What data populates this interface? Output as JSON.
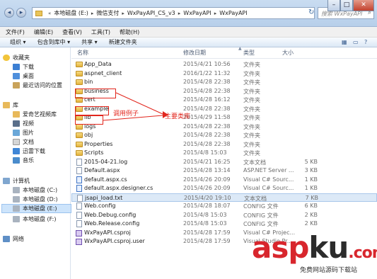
{
  "address_bar": {
    "crumbs": [
      "本地磁盘 (E:)",
      "微信支付",
      "WxPayAPI_CS_v3",
      "WxPayAPI",
      "WxPayAPI"
    ],
    "search_placeholder": "搜索 WxPayAPI"
  },
  "window_buttons": {
    "minimize": "–",
    "maximize": "□",
    "close": "✕"
  },
  "menu": [
    "文件(F)",
    "编辑(E)",
    "查看(V)",
    "工具(T)",
    "帮助(H)"
  ],
  "toolbar": [
    "组织 ▾",
    "包含到库中 ▾",
    "共享 ▾",
    "新建文件夹"
  ],
  "sidebar": {
    "favorites": {
      "label": "收藏夹",
      "items": [
        "下载",
        "桌面",
        "最近访问的位置"
      ]
    },
    "libraries": {
      "label": "库",
      "items": [
        "爱奇艺视频库",
        "视频",
        "图片",
        "文档",
        "迅雷下载",
        "音乐"
      ]
    },
    "computer": {
      "label": "计算机",
      "items": [
        "本地磁盘 (C:)",
        "本地磁盘 (D:)",
        "本地磁盘 (E:)",
        "本地磁盘 (F:)"
      ]
    },
    "network": {
      "label": "网络"
    }
  },
  "columns": {
    "name": "名称",
    "date": "修改日期",
    "type": "类型",
    "size": "大小"
  },
  "files": [
    {
      "name": "App_Data",
      "date": "2015/4/21 10:56",
      "type": "文件夹",
      "size": "",
      "icon": "folder"
    },
    {
      "name": "aspnet_client",
      "date": "2016/1/22 11:32",
      "type": "文件夹",
      "size": "",
      "icon": "folder"
    },
    {
      "name": "bin",
      "date": "2015/4/28 22:38",
      "type": "文件夹",
      "size": "",
      "icon": "folder"
    },
    {
      "name": "business",
      "date": "2015/4/28 22:38",
      "type": "文件夹",
      "size": "",
      "icon": "folder"
    },
    {
      "name": "cert",
      "date": "2015/4/28 16:12",
      "type": "文件夹",
      "size": "",
      "icon": "folder"
    },
    {
      "name": "example",
      "date": "2015/4/28 22:38",
      "type": "文件夹",
      "size": "",
      "icon": "folder"
    },
    {
      "name": "lib",
      "date": "2015/4/29 11:58",
      "type": "文件夹",
      "size": "",
      "icon": "folder"
    },
    {
      "name": "logs",
      "date": "2015/4/28 22:38",
      "type": "文件夹",
      "size": "",
      "icon": "folder"
    },
    {
      "name": "obj",
      "date": "2015/4/28 22:38",
      "type": "文件夹",
      "size": "",
      "icon": "folder"
    },
    {
      "name": "Properties",
      "date": "2015/4/28 22:38",
      "type": "文件夹",
      "size": "",
      "icon": "folder"
    },
    {
      "name": "Scripts",
      "date": "2015/4/8 15:03",
      "type": "文件夹",
      "size": "",
      "icon": "folder"
    },
    {
      "name": "2015-04-21.log",
      "date": "2015/4/21 16:25",
      "type": "文本文档",
      "size": "5 KB",
      "icon": "file"
    },
    {
      "name": "Default.aspx",
      "date": "2015/4/28 13:14",
      "type": "ASP.NET Server ...",
      "size": "3 KB",
      "icon": "file"
    },
    {
      "name": "default.aspx.cs",
      "date": "2015/4/26 20:09",
      "type": "Visual C# Sourc...",
      "size": "1 KB",
      "icon": "cs"
    },
    {
      "name": "default.aspx.designer.cs",
      "date": "2015/4/26 20:09",
      "type": "Visual C# Sourc...",
      "size": "1 KB",
      "icon": "cs"
    },
    {
      "name": "jsapi_load.txt",
      "date": "2015/4/20 19:10",
      "type": "文本文档",
      "size": "7 KB",
      "icon": "file"
    },
    {
      "name": "Web.config",
      "date": "2015/4/28 18:07",
      "type": "CONFIG 文件",
      "size": "6 KB",
      "icon": "file"
    },
    {
      "name": "Web.Debug.config",
      "date": "2015/4/8 15:03",
      "type": "CONFIG 文件",
      "size": "2 KB",
      "icon": "file"
    },
    {
      "name": "Web.Release.config",
      "date": "2015/4/8 15:03",
      "type": "CONFIG 文件",
      "size": "2 KB",
      "icon": "file"
    },
    {
      "name": "WxPayAPI.csproj",
      "date": "2015/4/28 17:59",
      "type": "Visual C# Projec...",
      "size": "",
      "icon": "proj"
    },
    {
      "name": "WxPayAPI.csproj.user",
      "date": "2015/4/28 17:59",
      "type": "Visual Studio Pr...",
      "size": "",
      "icon": "proj"
    }
  ],
  "annotations": {
    "example_note": "调用例子",
    "lib_note": "主要类库"
  },
  "watermark": {
    "brand_a": "asp",
    "brand_b": "ku",
    "brand_c": ".com",
    "sub": "免费网站源码下载站"
  }
}
